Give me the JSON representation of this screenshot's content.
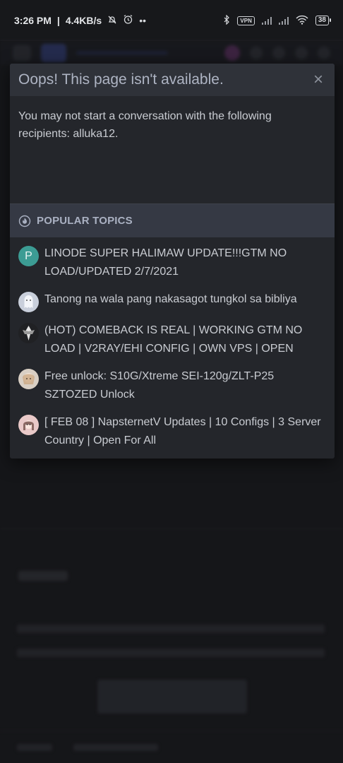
{
  "status_bar": {
    "time": "3:26 PM",
    "speed": "4.4KB/s",
    "vpn": "VPN",
    "battery": "38",
    "icons": [
      "bell-off-icon",
      "alarm-icon",
      "more-icon",
      "bluetooth-icon",
      "signal-icon",
      "wifi-icon",
      "battery-icon"
    ]
  },
  "modal": {
    "title": "Oops! This page isn't available.",
    "close_label": "×",
    "message": "You may not start a conversation with the following recipients: alluka12."
  },
  "popular_topics": {
    "header": "POPULAR TOPICS",
    "items": [
      {
        "title": "LINODE SUPER HALIMAW UPDATE!!!GTM NO LOAD/UPDATED 2/7/2021",
        "avatar_letter": "P",
        "avatar_color": "#3c9c94"
      },
      {
        "title": "Tanong na wala pang nakasagot tungkol sa bibliya"
      },
      {
        "title": "(HOT) COMEBACK IS REAL | WORKING GTM NO LOAD | V2RAY/EHI CONFIG | OWN VPS | OPEN"
      },
      {
        "title": "Free unlock: S10G/Xtreme SEI-120g/ZLT-P25 SZTOZED Unlock"
      },
      {
        "title": "[ FEB 08 ] NapsternetV Updates | 10 Configs | 3 Server Country | Open For All"
      }
    ]
  },
  "colors": {
    "background": "#1e1f23",
    "modal_bg": "#24262b",
    "modal_header": "#2f3239",
    "topics_header": "#353944",
    "title_text": "#aeb4c3"
  }
}
